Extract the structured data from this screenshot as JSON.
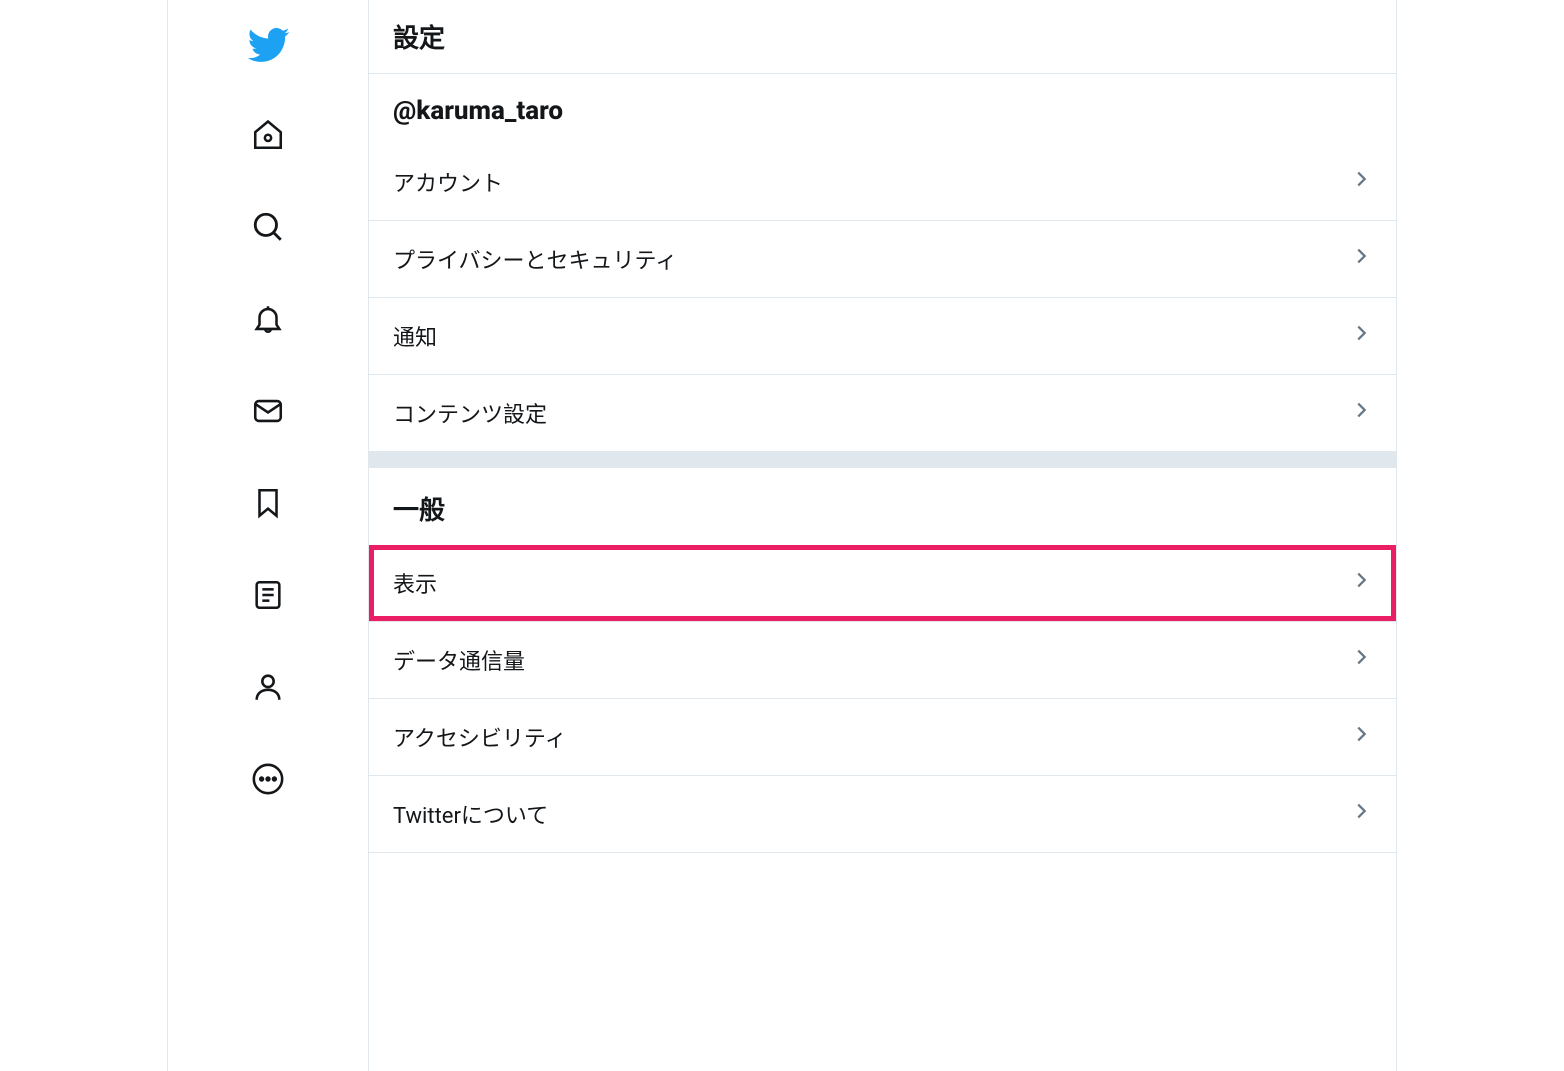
{
  "page": {
    "title": "設定"
  },
  "account": {
    "username": "@karuma_taro",
    "items": [
      {
        "label": "アカウント"
      },
      {
        "label": "プライバシーとセキュリティ"
      },
      {
        "label": "通知"
      },
      {
        "label": "コンテンツ設定"
      }
    ]
  },
  "general": {
    "header": "一般",
    "items": [
      {
        "label": "表示",
        "highlighted": true
      },
      {
        "label": "データ通信量"
      },
      {
        "label": "アクセシビリティ"
      },
      {
        "label": "Twitterについて"
      }
    ]
  }
}
